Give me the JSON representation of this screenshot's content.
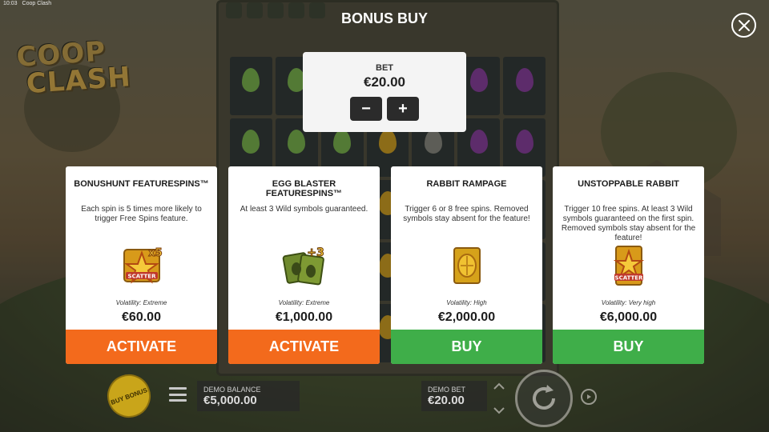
{
  "status_bar": {
    "time": "10:03",
    "window_title": "Coop Clash"
  },
  "logo": {
    "line1": "COOP",
    "line2": "CLASH"
  },
  "header": {
    "title": "BONUS BUY",
    "close_icon": "close-icon"
  },
  "bet": {
    "label": "BET",
    "value": "€20.00",
    "decrease_label": "−",
    "increase_label": "+"
  },
  "cards": [
    {
      "name": "BONUSHUNT FEATURESPINS™",
      "description": "Each spin is 5 times more likely to trigger Free Spins feature.",
      "icon": "scatter-x5-icon",
      "volatility": "Volatility: Extreme",
      "price": "€60.00",
      "button": "ACTIVATE",
      "button_color": "#f36a1c"
    },
    {
      "name": "EGG BLASTER FEATURESPINS™",
      "description": "At least 3 Wild symbols guaranteed.",
      "icon": "wild-plus3-icon",
      "volatility": "Volatility: Extreme",
      "price": "€1,000.00",
      "button": "ACTIVATE",
      "button_color": "#f36a1c"
    },
    {
      "name": "RABBIT RAMPAGE",
      "description": "Trigger 6 or 8 free spins. Removed symbols stay absent for the feature!",
      "icon": "golden-egg-card-icon",
      "volatility": "Volatility: High",
      "price": "€2,000.00",
      "button": "BUY",
      "button_color": "#3fae49"
    },
    {
      "name": "UNSTOPPABLE RABBIT",
      "description": "Trigger 10 free spins. At least 3 Wild symbols guaranteed on the first spin. Removed symbols stay absent for the feature!",
      "icon": "scatter-card-icon",
      "volatility": "Volatility: Very high",
      "price": "€6,000.00",
      "button": "BUY",
      "button_color": "#3fae49"
    }
  ],
  "bottom_bar": {
    "buy_bonus_label": "BUY BONUS",
    "balance_label": "DEMO BALANCE",
    "balance_value": "€5,000.00",
    "bet_label": "DEMO BET",
    "bet_value": "€20.00"
  },
  "colors": {
    "orange_button": "#f36a1c",
    "green_button": "#3fae49",
    "card_bg": "#ffffff",
    "bet_panel_bg": "#f4f4f4"
  }
}
